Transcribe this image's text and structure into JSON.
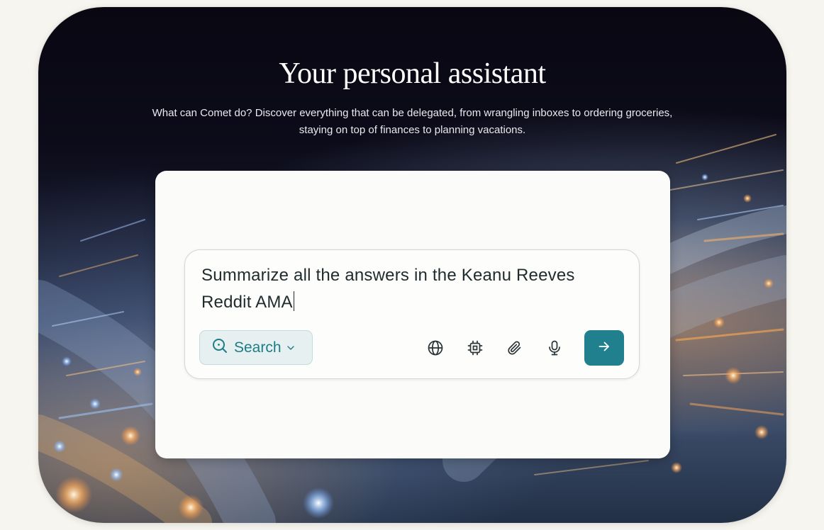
{
  "hero": {
    "title": "Your personal assistant",
    "subtitle": "What can Comet do? Discover everything that can be delegated, from wrangling inboxes to ordering groceries, staying on top of finances to planning vacations."
  },
  "prompt": {
    "query": "Summarize all the answers in the Keanu Reeves Reddit AMA"
  },
  "toolbar": {
    "mode_label": "Search",
    "icons": [
      "search-mode-icon",
      "chevron-down-icon",
      "globe-icon",
      "cpu-chip-icon",
      "paperclip-icon",
      "microphone-icon",
      "arrow-right-icon"
    ]
  },
  "colors": {
    "accent": "#21808d",
    "accent_text": "#1e7c86",
    "pill_bg": "#e6f0f1",
    "panel_bg": "#fbfbf9",
    "page_bg": "#f7f5ef"
  }
}
